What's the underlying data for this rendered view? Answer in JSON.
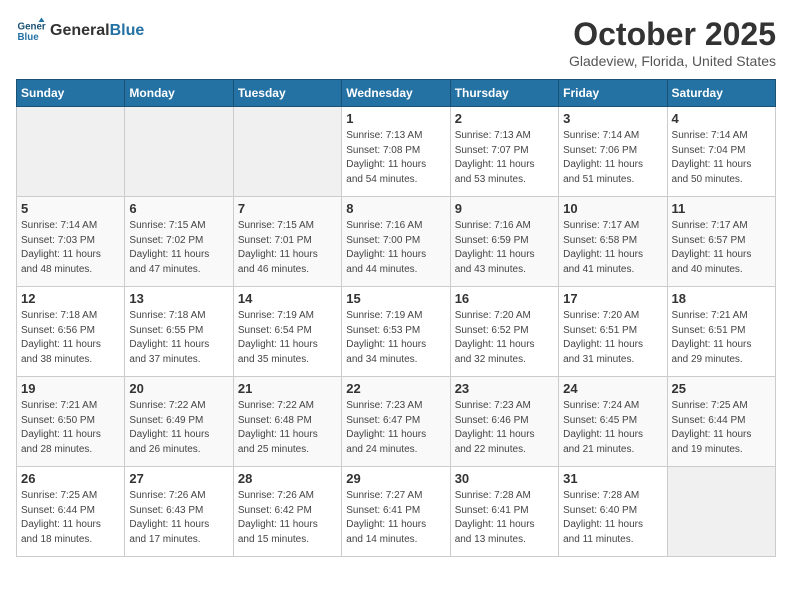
{
  "header": {
    "logo_line1": "General",
    "logo_line2": "Blue",
    "month": "October 2025",
    "location": "Gladeview, Florida, United States"
  },
  "weekdays": [
    "Sunday",
    "Monday",
    "Tuesday",
    "Wednesday",
    "Thursday",
    "Friday",
    "Saturday"
  ],
  "weeks": [
    [
      {
        "day": "",
        "info": ""
      },
      {
        "day": "",
        "info": ""
      },
      {
        "day": "",
        "info": ""
      },
      {
        "day": "1",
        "info": "Sunrise: 7:13 AM\nSunset: 7:08 PM\nDaylight: 11 hours\nand 54 minutes."
      },
      {
        "day": "2",
        "info": "Sunrise: 7:13 AM\nSunset: 7:07 PM\nDaylight: 11 hours\nand 53 minutes."
      },
      {
        "day": "3",
        "info": "Sunrise: 7:14 AM\nSunset: 7:06 PM\nDaylight: 11 hours\nand 51 minutes."
      },
      {
        "day": "4",
        "info": "Sunrise: 7:14 AM\nSunset: 7:04 PM\nDaylight: 11 hours\nand 50 minutes."
      }
    ],
    [
      {
        "day": "5",
        "info": "Sunrise: 7:14 AM\nSunset: 7:03 PM\nDaylight: 11 hours\nand 48 minutes."
      },
      {
        "day": "6",
        "info": "Sunrise: 7:15 AM\nSunset: 7:02 PM\nDaylight: 11 hours\nand 47 minutes."
      },
      {
        "day": "7",
        "info": "Sunrise: 7:15 AM\nSunset: 7:01 PM\nDaylight: 11 hours\nand 46 minutes."
      },
      {
        "day": "8",
        "info": "Sunrise: 7:16 AM\nSunset: 7:00 PM\nDaylight: 11 hours\nand 44 minutes."
      },
      {
        "day": "9",
        "info": "Sunrise: 7:16 AM\nSunset: 6:59 PM\nDaylight: 11 hours\nand 43 minutes."
      },
      {
        "day": "10",
        "info": "Sunrise: 7:17 AM\nSunset: 6:58 PM\nDaylight: 11 hours\nand 41 minutes."
      },
      {
        "day": "11",
        "info": "Sunrise: 7:17 AM\nSunset: 6:57 PM\nDaylight: 11 hours\nand 40 minutes."
      }
    ],
    [
      {
        "day": "12",
        "info": "Sunrise: 7:18 AM\nSunset: 6:56 PM\nDaylight: 11 hours\nand 38 minutes."
      },
      {
        "day": "13",
        "info": "Sunrise: 7:18 AM\nSunset: 6:55 PM\nDaylight: 11 hours\nand 37 minutes."
      },
      {
        "day": "14",
        "info": "Sunrise: 7:19 AM\nSunset: 6:54 PM\nDaylight: 11 hours\nand 35 minutes."
      },
      {
        "day": "15",
        "info": "Sunrise: 7:19 AM\nSunset: 6:53 PM\nDaylight: 11 hours\nand 34 minutes."
      },
      {
        "day": "16",
        "info": "Sunrise: 7:20 AM\nSunset: 6:52 PM\nDaylight: 11 hours\nand 32 minutes."
      },
      {
        "day": "17",
        "info": "Sunrise: 7:20 AM\nSunset: 6:51 PM\nDaylight: 11 hours\nand 31 minutes."
      },
      {
        "day": "18",
        "info": "Sunrise: 7:21 AM\nSunset: 6:51 PM\nDaylight: 11 hours\nand 29 minutes."
      }
    ],
    [
      {
        "day": "19",
        "info": "Sunrise: 7:21 AM\nSunset: 6:50 PM\nDaylight: 11 hours\nand 28 minutes."
      },
      {
        "day": "20",
        "info": "Sunrise: 7:22 AM\nSunset: 6:49 PM\nDaylight: 11 hours\nand 26 minutes."
      },
      {
        "day": "21",
        "info": "Sunrise: 7:22 AM\nSunset: 6:48 PM\nDaylight: 11 hours\nand 25 minutes."
      },
      {
        "day": "22",
        "info": "Sunrise: 7:23 AM\nSunset: 6:47 PM\nDaylight: 11 hours\nand 24 minutes."
      },
      {
        "day": "23",
        "info": "Sunrise: 7:23 AM\nSunset: 6:46 PM\nDaylight: 11 hours\nand 22 minutes."
      },
      {
        "day": "24",
        "info": "Sunrise: 7:24 AM\nSunset: 6:45 PM\nDaylight: 11 hours\nand 21 minutes."
      },
      {
        "day": "25",
        "info": "Sunrise: 7:25 AM\nSunset: 6:44 PM\nDaylight: 11 hours\nand 19 minutes."
      }
    ],
    [
      {
        "day": "26",
        "info": "Sunrise: 7:25 AM\nSunset: 6:44 PM\nDaylight: 11 hours\nand 18 minutes."
      },
      {
        "day": "27",
        "info": "Sunrise: 7:26 AM\nSunset: 6:43 PM\nDaylight: 11 hours\nand 17 minutes."
      },
      {
        "day": "28",
        "info": "Sunrise: 7:26 AM\nSunset: 6:42 PM\nDaylight: 11 hours\nand 15 minutes."
      },
      {
        "day": "29",
        "info": "Sunrise: 7:27 AM\nSunset: 6:41 PM\nDaylight: 11 hours\nand 14 minutes."
      },
      {
        "day": "30",
        "info": "Sunrise: 7:28 AM\nSunset: 6:41 PM\nDaylight: 11 hours\nand 13 minutes."
      },
      {
        "day": "31",
        "info": "Sunrise: 7:28 AM\nSunset: 6:40 PM\nDaylight: 11 hours\nand 11 minutes."
      },
      {
        "day": "",
        "info": ""
      }
    ]
  ]
}
